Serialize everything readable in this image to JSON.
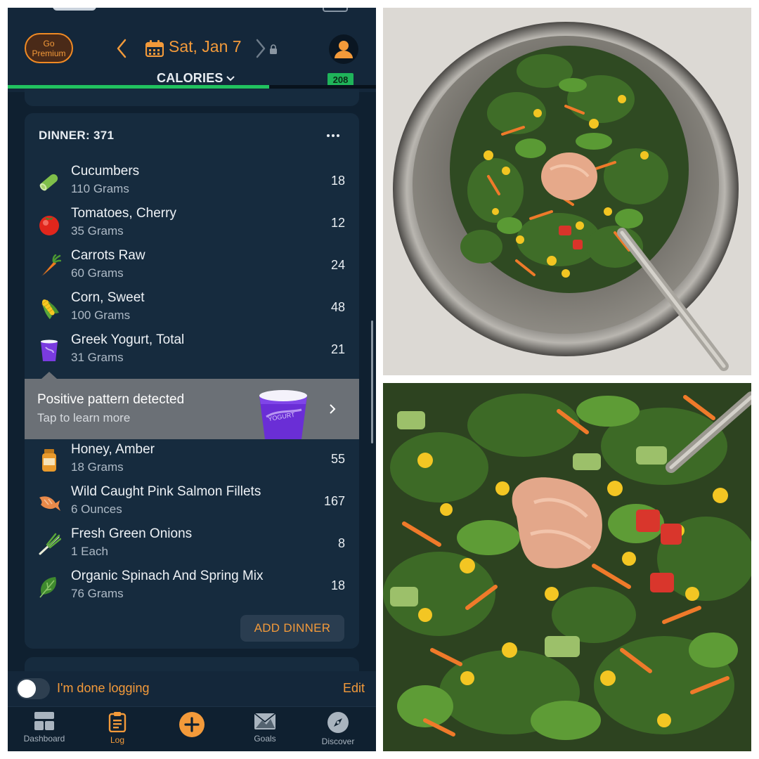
{
  "header": {
    "premium_label": "Go Premium",
    "date": "Sat, Jan 7",
    "metric": "CALORIES",
    "remaining": "208",
    "progress_fraction": 0.71
  },
  "meal": {
    "title": "DINNER: 371",
    "items": [
      {
        "name": "Cucumbers",
        "amount": "110 Grams",
        "calories": "18",
        "icon": "cucumber-icon"
      },
      {
        "name": "Tomatoes, Cherry",
        "amount": "35 Grams",
        "calories": "12",
        "icon": "tomato-icon"
      },
      {
        "name": "Carrots Raw",
        "amount": "60 Grams",
        "calories": "24",
        "icon": "carrot-icon"
      },
      {
        "name": "Corn, Sweet",
        "amount": "100 Grams",
        "calories": "48",
        "icon": "corn-icon"
      },
      {
        "name": "Greek Yogurt, Total",
        "amount": "31 Grams",
        "calories": "21",
        "icon": "yogurt-icon"
      },
      {
        "name": "Honey, Amber",
        "amount": "18 Grams",
        "calories": "55",
        "icon": "honey-jar-icon"
      },
      {
        "name": "Wild Caught Pink Salmon Fillets",
        "amount": "6 Ounces",
        "calories": "167",
        "icon": "fish-icon"
      },
      {
        "name": "Fresh Green Onions",
        "amount": "1 Each",
        "calories": "8",
        "icon": "green-onion-icon"
      },
      {
        "name": "Organic Spinach And Spring Mix",
        "amount": "76 Grams",
        "calories": "18",
        "icon": "spinach-leaf-icon"
      }
    ],
    "add_label": "ADD DINNER"
  },
  "insight": {
    "title": "Positive pattern detected",
    "subtitle": "Tap to learn more",
    "cup_text": "YOGURT"
  },
  "done_bar": {
    "label": "I'm done logging",
    "edit": "Edit"
  },
  "tabs": [
    {
      "label": "Dashboard",
      "icon": "dashboard-icon"
    },
    {
      "label": "Log",
      "icon": "log-clipboard-icon"
    },
    {
      "label": "",
      "icon": "add-plus-icon"
    },
    {
      "label": "Goals",
      "icon": "goals-envelope-icon"
    },
    {
      "label": "Discover",
      "icon": "compass-icon"
    }
  ],
  "colors": {
    "accent": "#f39a3a",
    "background": "#0f2030",
    "card": "#162b3e",
    "progress": "#21c25f"
  }
}
